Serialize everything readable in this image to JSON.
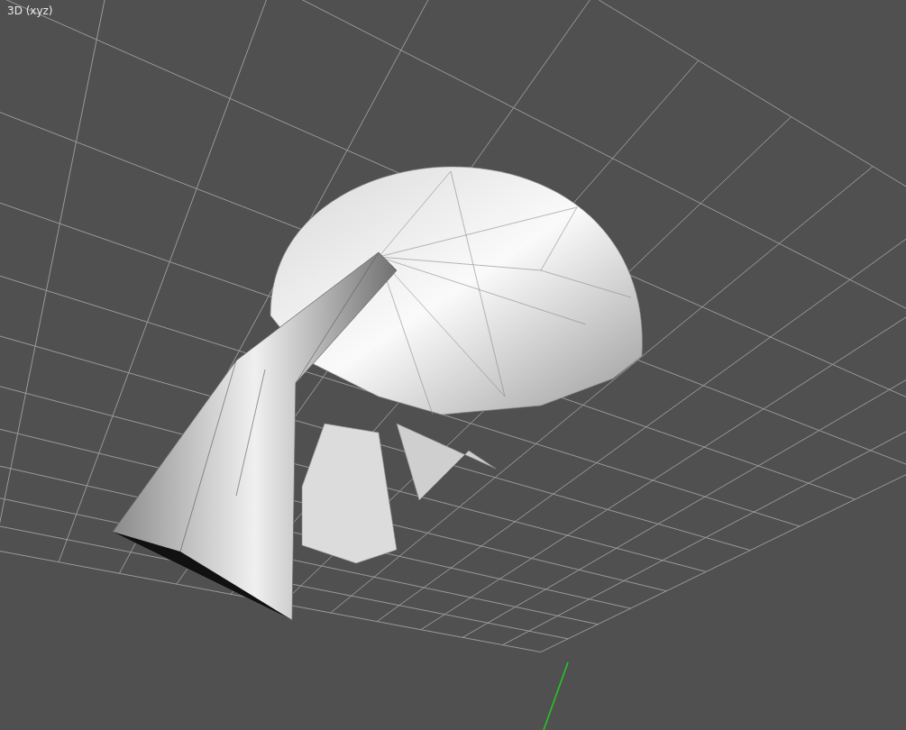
{
  "viewport": {
    "label": "3D (xyz)"
  }
}
